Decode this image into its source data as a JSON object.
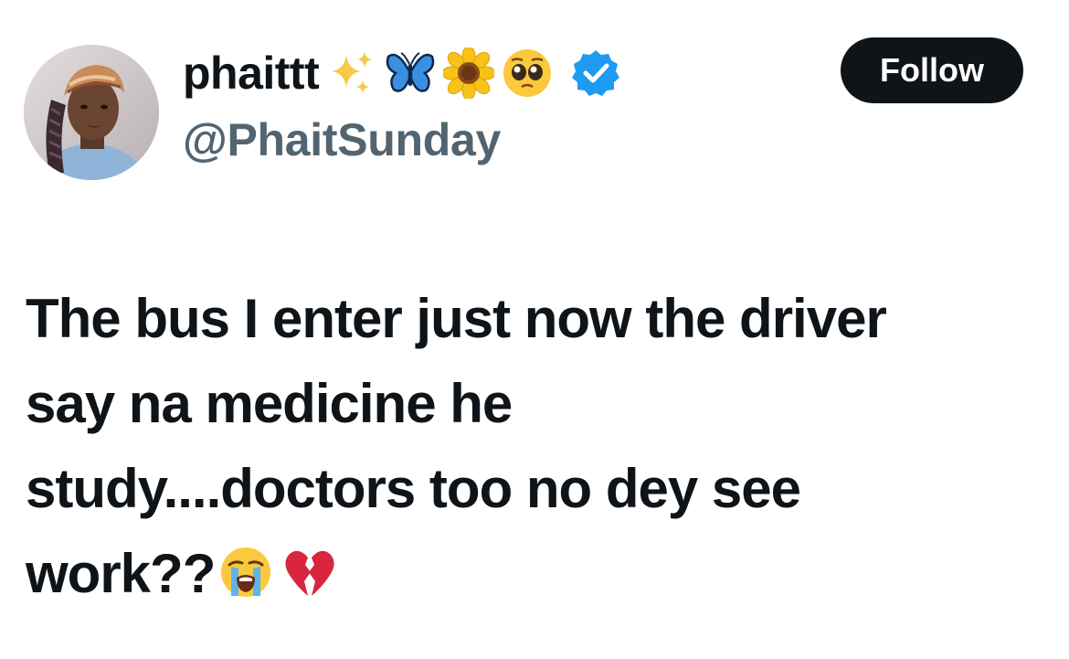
{
  "author": {
    "display_name": "phaittt",
    "name_emojis": [
      "sparkles-icon",
      "butterfly-icon",
      "sunflower-icon",
      "pleading-face-icon"
    ],
    "verified": true,
    "handle": "@PhaitSunday"
  },
  "follow_button": {
    "label": "Follow"
  },
  "tweet": {
    "lines": [
      "The bus I enter just now the driver",
      "say na medicine he",
      "study....doctors too no dey see",
      "work??"
    ],
    "trailing_emojis": [
      "loudly-crying-face-icon",
      "broken-heart-icon"
    ]
  },
  "colors": {
    "text_primary": "#0f1419",
    "text_secondary": "#536471",
    "verified_blue": "#1d9bf0",
    "button_bg": "#0f1419",
    "button_text": "#ffffff"
  }
}
